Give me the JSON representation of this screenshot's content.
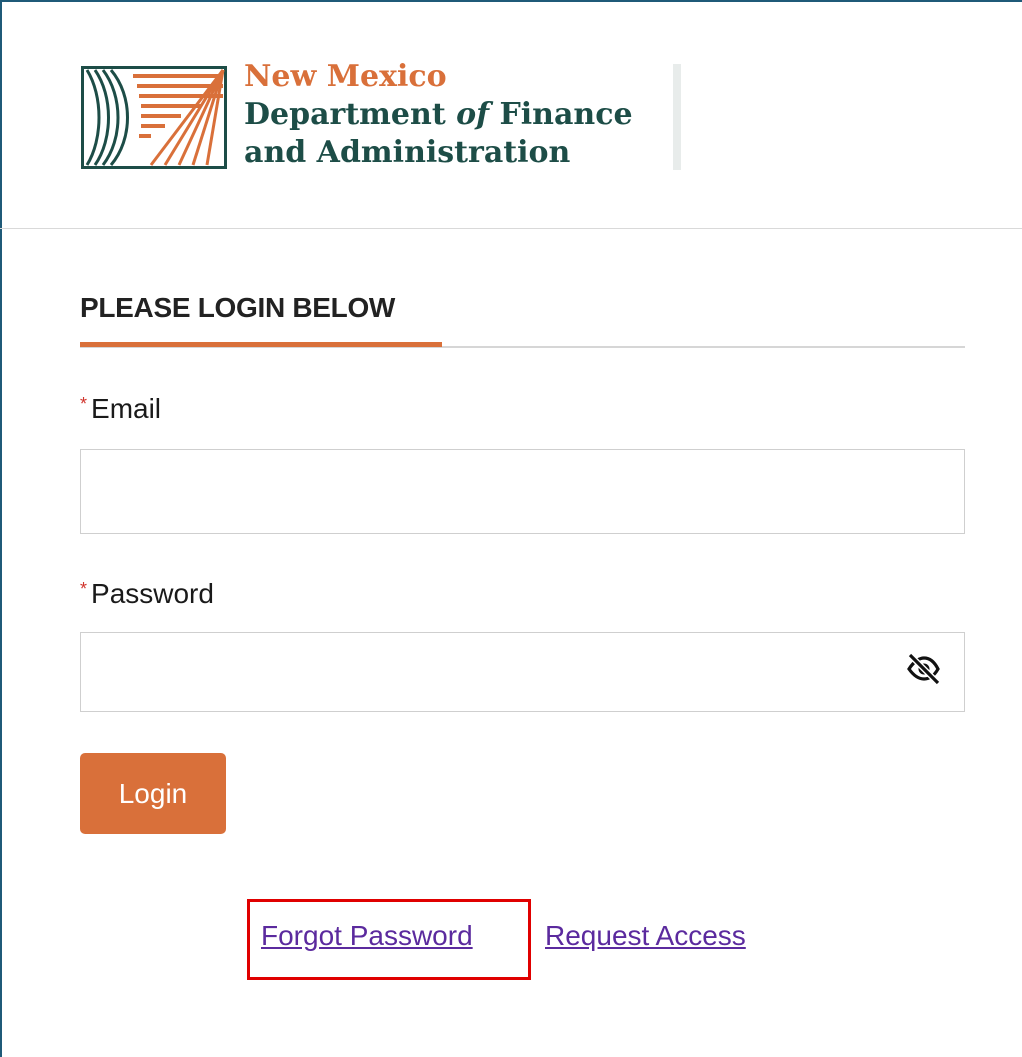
{
  "brand": {
    "line1": "New Mexico",
    "line2_prefix": "Department ",
    "line2_of": "of",
    "line2_suffix": " Finance",
    "line3": "and Administration",
    "logo_icon": "nm-dfa-logo-icon",
    "colors": {
      "orange": "#d9703a",
      "green": "#1d4d47"
    }
  },
  "form": {
    "heading": "PLEASE LOGIN BELOW",
    "required_marker": "*",
    "email": {
      "label": "Email",
      "value": "",
      "placeholder": ""
    },
    "password": {
      "label": "Password",
      "value": "",
      "placeholder": "",
      "toggle_icon": "eye-slash-icon"
    },
    "login_button": "Login"
  },
  "links": {
    "forgot_password": "Forgot Password",
    "request_access": "Request Access",
    "color": "#5b2a9e"
  },
  "annotation": {
    "highlight_color": "#e00000"
  }
}
